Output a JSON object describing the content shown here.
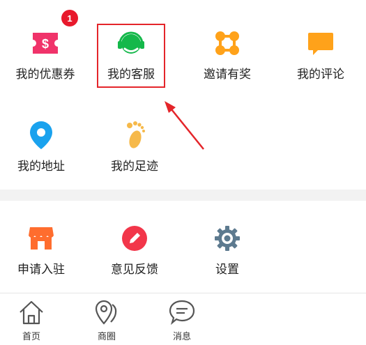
{
  "badge_count": "1",
  "menu_top": [
    {
      "label": "我的优惠券",
      "icon": "coupon-icon"
    },
    {
      "label": "我的客服",
      "icon": "customer-service-icon"
    },
    {
      "label": "邀请有奖",
      "icon": "invite-icon"
    },
    {
      "label": "我的评论",
      "icon": "comment-icon"
    },
    {
      "label": "我的地址",
      "icon": "location-pin-icon"
    },
    {
      "label": "我的足迹",
      "icon": "footprint-icon"
    }
  ],
  "menu_bottom": [
    {
      "label": "申请入驻",
      "icon": "store-icon"
    },
    {
      "label": "意见反馈",
      "icon": "pencil-icon"
    },
    {
      "label": "设置",
      "icon": "gear-icon"
    }
  ],
  "tabbar": [
    {
      "label": "首页",
      "icon": "home-icon"
    },
    {
      "label": "商圈",
      "icon": "map-pin-icon"
    },
    {
      "label": "消息",
      "icon": "chat-bubble-icon"
    }
  ],
  "colors": {
    "coupon": "#f0336a",
    "service": "#14b84a",
    "invite": "#ffa21a",
    "comment": "#ffa21a",
    "location": "#1aa2ee",
    "footprint": "#f6b94a",
    "store": "#ff6d2e",
    "feedback": "#f2364a",
    "settings": "#5d7a8f",
    "highlight": "#e4252a"
  }
}
